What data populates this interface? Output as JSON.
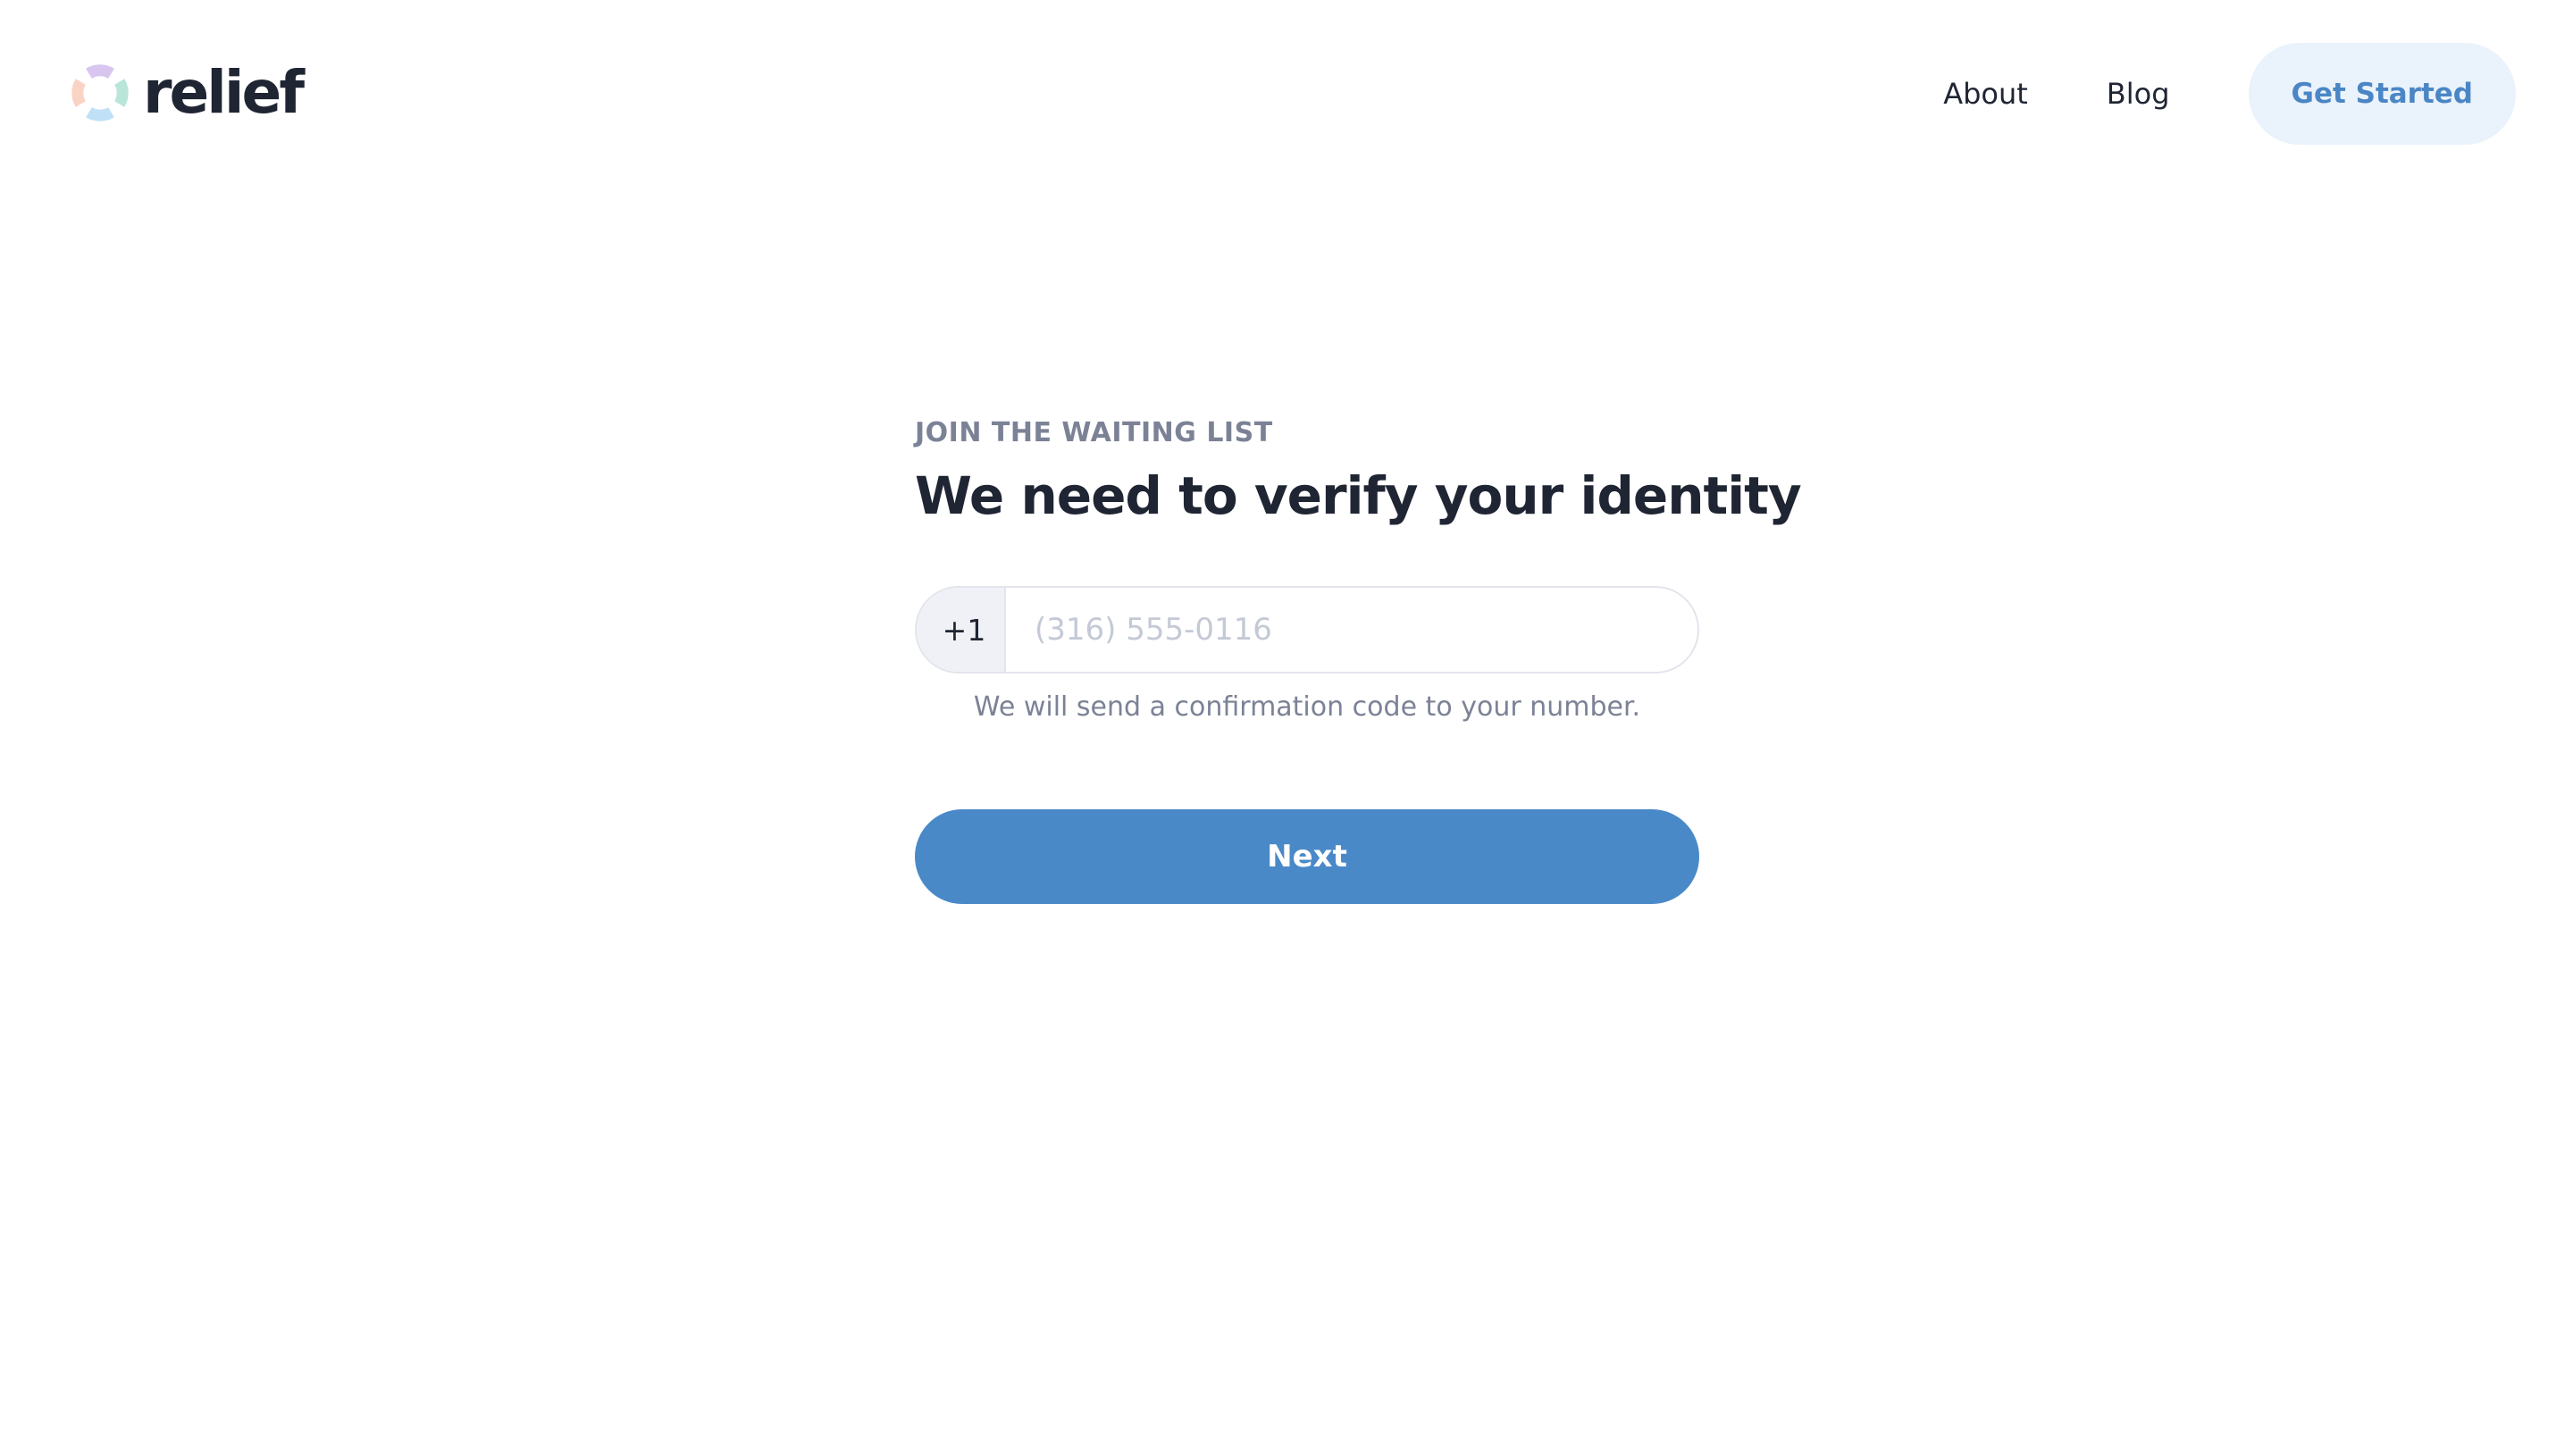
{
  "brand": {
    "name": "relief",
    "logo_icon": "lifebuoy-icon",
    "logo_colors": [
      "#d9c6f0",
      "#b9e6d8",
      "#bfe0f7",
      "#f9d4c4"
    ]
  },
  "nav": {
    "links": [
      {
        "label": "About"
      },
      {
        "label": "Blog"
      }
    ],
    "cta_label": "Get Started"
  },
  "form": {
    "eyebrow": "JOIN THE WAITING LIST",
    "title": "We need to verify your identity",
    "country_code": "+1",
    "phone_placeholder": "(316) 555-0116",
    "phone_value": "",
    "hint": "We will send a confirmation code to your number.",
    "submit_label": "Next"
  },
  "colors": {
    "accent": "#4a89c8",
    "cta_background": "#eaf2fb",
    "text_dark": "#1f2533",
    "text_muted": "#7c8296"
  }
}
